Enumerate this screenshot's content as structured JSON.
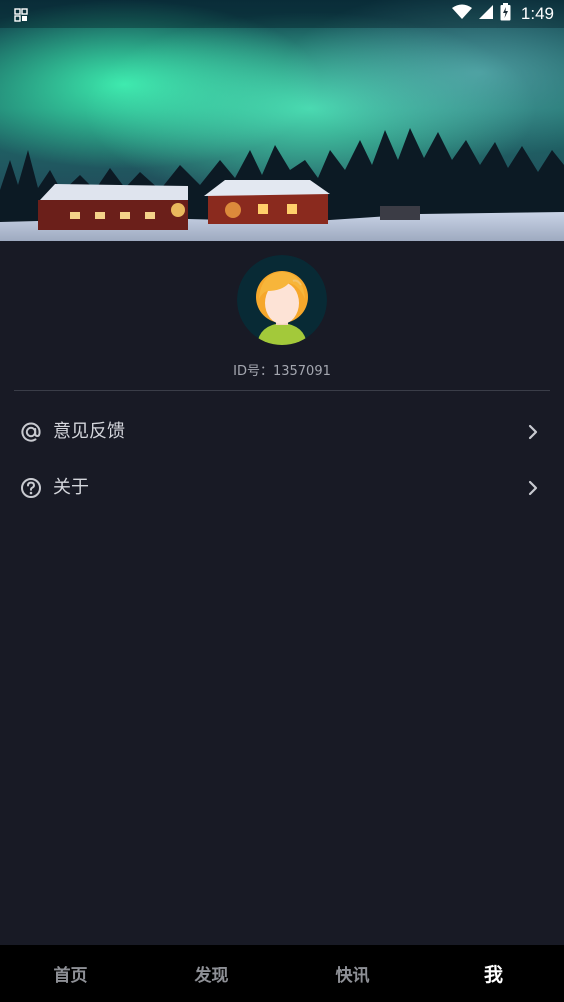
{
  "status_bar": {
    "time": "1:49",
    "icons": [
      "app-notification-icon",
      "wifi-icon",
      "cell-signal-icon",
      "battery-charging-icon"
    ]
  },
  "header": {
    "image": "aurora-winter-village"
  },
  "profile": {
    "id_text": "ID号：1357091"
  },
  "menu": {
    "items": [
      {
        "label": "意见反馈",
        "icon": "at-sign-icon"
      },
      {
        "label": "关于",
        "icon": "question-circle-icon"
      }
    ]
  },
  "tabbar": {
    "tabs": [
      {
        "label": "首页"
      },
      {
        "label": "发现"
      },
      {
        "label": "快讯"
      },
      {
        "label": "我"
      }
    ],
    "active": "我"
  },
  "colors": {
    "background": "#181a25",
    "text": "#d4d6dc",
    "muted": "#a4a7b0",
    "tabbar": "#000000"
  }
}
